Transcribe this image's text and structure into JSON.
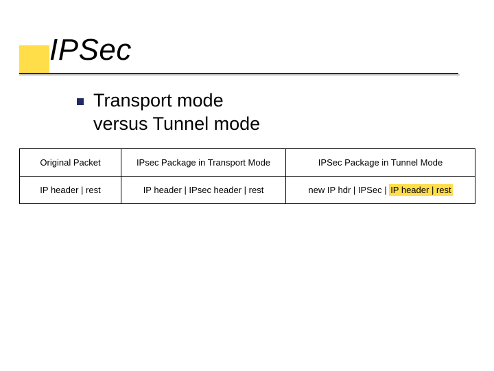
{
  "title": "IPSec",
  "bullet": "Transport mode\nversus Tunnel mode",
  "table": {
    "headers": [
      "Original Packet",
      "IPsec Package in Transport Mode",
      "IPSec Package in Tunnel Mode"
    ],
    "row": {
      "c1": "IP header | rest",
      "c2": "IP header | IPsec header | rest",
      "c3_prefix": "new IP hdr | IPSec | ",
      "c3_hl": "IP header | rest"
    }
  }
}
